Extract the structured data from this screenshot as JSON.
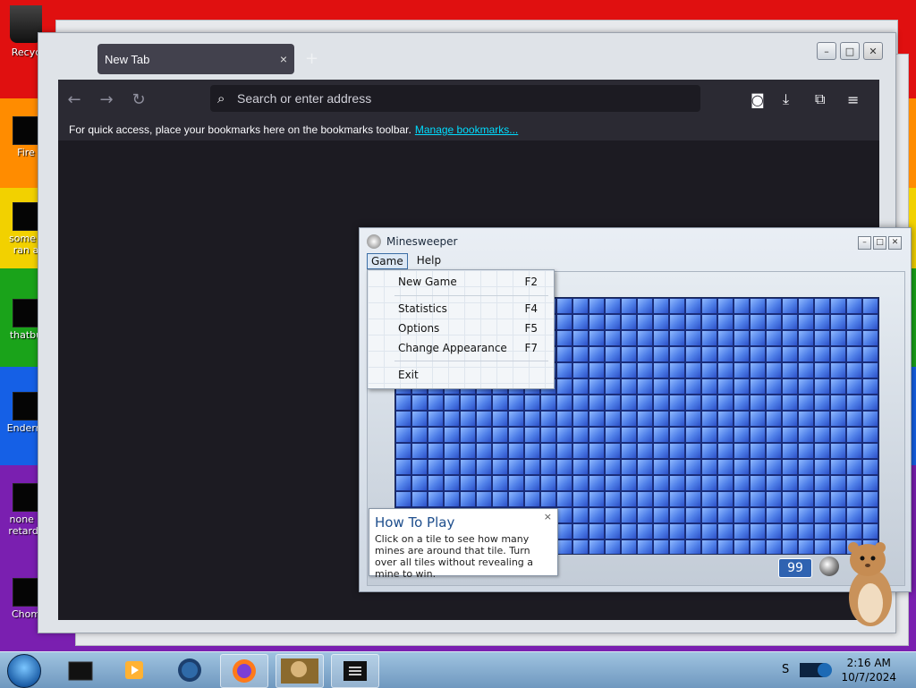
{
  "desktop": {
    "icons": [
      {
        "label": "Recyc",
        "icon": "recycle-bin-icon"
      },
      {
        "label": "Fire",
        "icon": "shortcut-icon"
      },
      {
        "label": "some r ran a",
        "icon": "shortcut-icon"
      },
      {
        "label": "thatbu",
        "icon": "shortcut-icon"
      },
      {
        "label": "Enderm",
        "icon": "shortcut-icon"
      },
      {
        "label": "none c retards",
        "icon": "shortcut-icon"
      },
      {
        "label": "Chom",
        "icon": "shortcut-icon"
      }
    ]
  },
  "browser": {
    "tab_title": "New Tab",
    "tab_close": "×",
    "new_tab": "+",
    "url_placeholder": "Search or enter address",
    "bookmarks_text": "For quick access, place your bookmarks here on the bookmarks toolbar.",
    "bookmarks_link": "Manage bookmarks...",
    "window_controls": {
      "minimize": "–",
      "maximize": "□",
      "close": "✕"
    }
  },
  "minesweeper": {
    "title": "Minesweeper",
    "menu": {
      "game": "Game",
      "help": "Help"
    },
    "game_menu": [
      {
        "label": "New Game",
        "shortcut": "F2"
      },
      {
        "label": "Statistics",
        "shortcut": "F4"
      },
      {
        "label": "Options",
        "shortcut": "F5"
      },
      {
        "label": "Change Appearance",
        "shortcut": "F7"
      },
      {
        "label": "Exit",
        "shortcut": ""
      }
    ],
    "mine_counter": "99",
    "rows": 16,
    "cols": 30,
    "howto": {
      "title": "How To Play",
      "body": "Click on a tile to see how many mines are around that tile. Turn over all tiles without revealing a mine to win.",
      "close": "×"
    }
  },
  "taskbar": {
    "tray_text": "S",
    "time": "2:16 AM",
    "date": "10/7/2024"
  }
}
